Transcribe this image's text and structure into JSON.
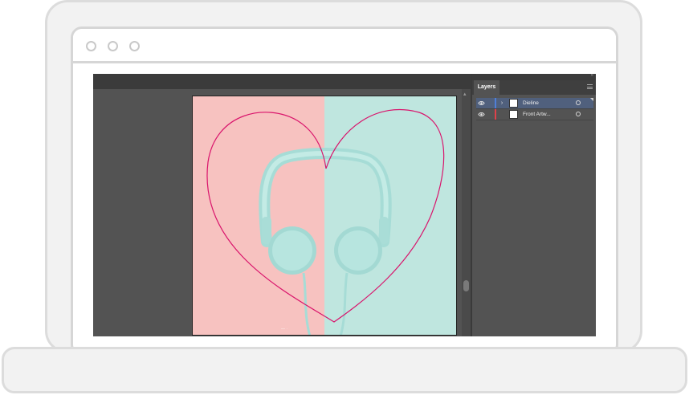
{
  "colors": {
    "device_frame": "#f2f2f2",
    "app_background": "#535353",
    "artboard_left": "#f7c2c0",
    "artboard_right": "#bfe6df",
    "dieline_stroke": "#d9136b",
    "selection_highlight": "#50607d"
  },
  "window": {
    "controls": [
      "window-dot-icon",
      "window-dot-icon",
      "window-dot-icon"
    ]
  },
  "canvas": {
    "artboard_label": "— ·"
  },
  "layers_panel": {
    "collapse_icon": "double-chevron-right-icon",
    "tab_label": "Layers",
    "menu_icon": "hamburger-menu-icon",
    "layers": [
      {
        "name": "Dieline",
        "visible": true,
        "selected": true,
        "color": "#4f7fd8",
        "expander": "›"
      },
      {
        "name": "Front Artw...",
        "visible": true,
        "selected": false,
        "color": "#e0414a",
        "expander": ""
      }
    ]
  }
}
